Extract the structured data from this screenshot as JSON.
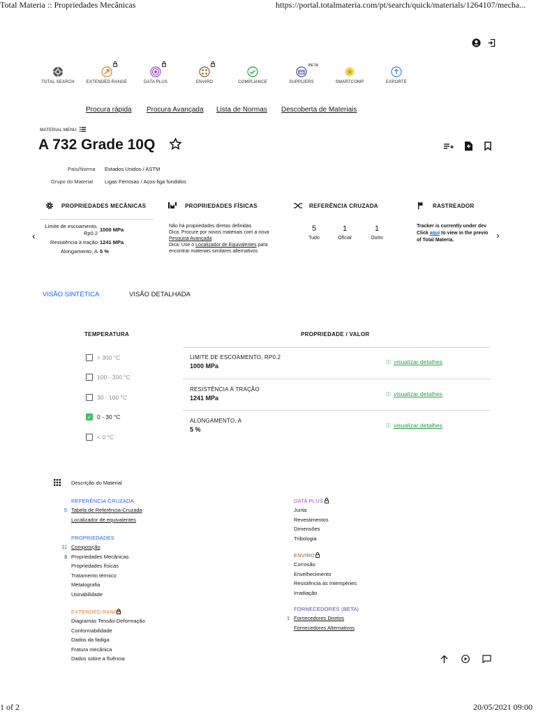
{
  "print_header": {
    "title": "Total Materia :: Propriedades Mecânicas",
    "url": "https://portal.totalmateria.com/pt/search/quick/materials/1264107/mecha..."
  },
  "print_footer": {
    "page": "1 of 2",
    "datetime": "20/05/2021 09:00"
  },
  "top_nav": [
    {
      "label": "TOTAL SEARCH",
      "icon": "total-search-icon",
      "color": "#555555",
      "locked": false
    },
    {
      "label": "EXTENDED RANGE",
      "icon": "extended-range-icon",
      "color": "#e07b24",
      "locked": true
    },
    {
      "label": "DATA PLUS",
      "icon": "data-plus-icon",
      "color": "#a24bc7",
      "locked": true
    },
    {
      "label": "ENVIRO",
      "icon": "enviro-icon",
      "color": "#8b5a2b",
      "locked": true
    },
    {
      "label": "COMPLIANCE",
      "icon": "compliance-icon",
      "color": "#24a148",
      "locked": false
    },
    {
      "label": "SUPPLIERS",
      "icon": "suppliers-icon",
      "color": "#4b4f9e",
      "locked": false,
      "badge": "BETA"
    },
    {
      "label": "SMARTCOMP",
      "icon": "smartcomp-icon",
      "color": "#e8c300",
      "locked": false
    },
    {
      "label": "EXPORTE",
      "icon": "export-icon",
      "color": "#3d8bd6",
      "locked": false
    }
  ],
  "sub_nav": [
    "Procura rápida",
    "Procura Avançada",
    "Lista de Normas",
    "Descoberta de Materiais"
  ],
  "material_menu": "MATERIAL MENU",
  "material": {
    "name": "A 732 Grade 10Q",
    "country_label": "País/Norma",
    "country_value": "Estados Unidos / ASTM",
    "group_label": "Grupo do Material",
    "group_value": "Ligas Ferrosas / Aços-liga fundidos"
  },
  "cards": {
    "mech": {
      "title": "PROPRIEDADES MECÂNICAS",
      "rows": [
        {
          "label": "Limite de escoamento, Rp0.2",
          "value": "1000 MPa"
        },
        {
          "label": "Resistência à tração",
          "value": "1241 MPa"
        },
        {
          "label": "Alongamento, A",
          "value": "5 %"
        }
      ]
    },
    "phys": {
      "title": "PROPRIEDADES FÍSICAS",
      "line1": "Não há propriedades diretas definidas",
      "line2a": "Dica: Procure por novos materiais com a nova ",
      "line2link": "Pesquisa Avançada",
      "line3a": "Dica: Use o ",
      "line3link": "Localizador de Equivalentes",
      "line3b": " para encontrar materiais similares alternativos"
    },
    "cross": {
      "title": "REFERÊNCIA CRUZADA",
      "stats": [
        {
          "value": "5",
          "label": "Tudo"
        },
        {
          "value": "1",
          "label": "Oficial"
        },
        {
          "value": "1",
          "label": "Outro"
        }
      ]
    },
    "tracker": {
      "title": "RASTREADOR",
      "text1": "Tracker is currently under dev",
      "text2a": "Click ",
      "text2link": "aqui",
      "text2b": " to view in the previo",
      "text3": "of Total Materia."
    }
  },
  "view_tabs": {
    "synthetic": "VISÃO SINTÉTICA",
    "detailed": "VISÃO DETALHADA"
  },
  "table": {
    "temp_header": "TEMPERATURA",
    "prop_header": "PROPRIEDADE / VALOR",
    "temperatures": [
      {
        "label": "> 300 °C",
        "checked": false
      },
      {
        "label": "100 - 300 °C",
        "checked": false
      },
      {
        "label": "30 - 100 °C",
        "checked": false
      },
      {
        "label": "0 - 30 °C",
        "checked": true
      },
      {
        "label": "< 0 °C",
        "checked": false
      }
    ],
    "rows": [
      {
        "name": "LIMITE DE ESCOAMENTO, RP0.2",
        "value": "1000 MPa",
        "link": "visualizar detalhes"
      },
      {
        "name": "RESISTÊNCIA À TRAÇÃO",
        "value": "1241 MPa",
        "link": "visualizar detalhes"
      },
      {
        "name": "ALONGAMENTO, A",
        "value": "5 %",
        "link": "visualizar detalhes"
      }
    ]
  },
  "description": {
    "title": "Descrição do Material",
    "left": {
      "cross_ref": {
        "title": "REFERÊNCIA CRUZADA",
        "color": "#0f62fe",
        "items": [
          {
            "count": "5",
            "label": "Tabela de Referência-Cruzada",
            "link": true
          },
          {
            "count": "",
            "label": "Localizador de equivalentes",
            "link": true
          }
        ]
      },
      "props": {
        "title": "PROPRIEDADES",
        "color": "#0f62fe",
        "items": [
          {
            "count": "11",
            "label": "Composição",
            "link": true
          },
          {
            "count": "3",
            "label": "Propriedades Mecânicas",
            "link": false
          },
          {
            "count": "",
            "label": "Propriedades físicas",
            "link": false
          },
          {
            "count": "",
            "label": "Tratamento térmico",
            "link": false
          },
          {
            "count": "",
            "label": "Metalografia",
            "link": false
          },
          {
            "count": "",
            "label": "Usinabilidade",
            "link": false
          }
        ]
      },
      "ext": {
        "title": "EXTENDED RANGE",
        "color": "#e07b24",
        "items": [
          {
            "label": "Diagramas Tensão-Deformação"
          },
          {
            "label": "Conformabilidade"
          },
          {
            "label": "Dados da fadiga"
          },
          {
            "label": "Fratura mecânica"
          },
          {
            "label": "Dados sobre a fluência"
          }
        ]
      }
    },
    "right": {
      "dataplus": {
        "title": "DATA PLUS",
        "color": "#a24bc7",
        "items": [
          {
            "label": "Junta"
          },
          {
            "label": "Revestimentos"
          },
          {
            "label": "Dimensões"
          },
          {
            "label": "Tribologia"
          }
        ]
      },
      "enviro": {
        "title": "ENVIRO",
        "color": "#8b5a2b",
        "items": [
          {
            "label": "Corrosão"
          },
          {
            "label": "Envelhecimento"
          },
          {
            "label": "Resistência às Intempéries"
          },
          {
            "label": "Irradiação"
          }
        ]
      },
      "suppliers": {
        "title": "FORNECEDORES (BETA)",
        "color": "#4b4f9e",
        "items": [
          {
            "count": "1",
            "label": "Fornecedores Diretos",
            "link": true
          },
          {
            "count": "",
            "label": "Fornecedores Alternativos",
            "link": true
          }
        ]
      }
    }
  }
}
